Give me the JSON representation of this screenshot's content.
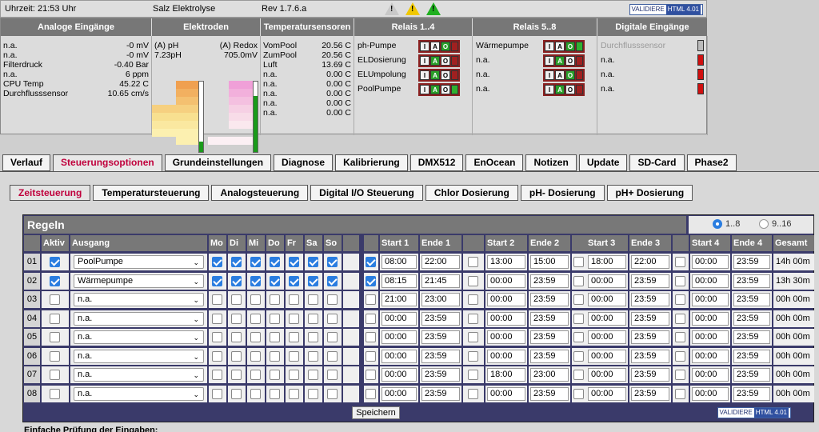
{
  "statusbar": {
    "time": "Uhrzeit: 21:53 Uhr",
    "device": "Salz Elektrolyse",
    "rev": "Rev 1.7.6.a",
    "badge_left": "VALIDIERE",
    "badge_right": "HTML 4.01"
  },
  "panel": {
    "headers": [
      "Analoge Eingänge",
      "Elektroden",
      "Temperatursensoren",
      "Relais 1..4",
      "Relais 5..8",
      "Digitale Eingänge"
    ],
    "analog": [
      {
        "l": "n.a.",
        "v": "-0 mV"
      },
      {
        "l": "n.a.",
        "v": "-0 mV"
      },
      {
        "l": "Filterdruck",
        "v": "-0.40 Bar"
      },
      {
        "l": "n.a.",
        "v": "6 ppm"
      },
      {
        "l": "CPU Temp",
        "v": "45.22 C"
      },
      {
        "l": "Durchflusssensor",
        "v": "10.65 cm/s"
      }
    ],
    "electrodes": {
      "ph_label": "(A) pH",
      "ph_value": "7.23pH",
      "redox_label": "(A) Redox",
      "redox_value": "705.0mV",
      "ph_level": 0.15,
      "redox_level": 0.8
    },
    "temps": [
      {
        "l": "VomPool",
        "v": "20.56 C"
      },
      {
        "l": "ZumPool",
        "v": "20.56 C"
      },
      {
        "l": "Luft",
        "v": "13.69 C"
      },
      {
        "l": "n.a.",
        "v": "0.00 C"
      },
      {
        "l": "n.a.",
        "v": "0.00 C"
      },
      {
        "l": "n.a.",
        "v": "0.00 C"
      },
      {
        "l": "n.a.",
        "v": "0.00 C"
      },
      {
        "l": "n.a.",
        "v": "0.00 C"
      }
    ],
    "relays1": [
      {
        "l": "ph-Pumpe",
        "s": "off"
      },
      {
        "l": "ELDosierung",
        "s": "auto"
      },
      {
        "l": "ELUmpolung",
        "s": "auto"
      },
      {
        "l": "PoolPumpe",
        "s": "auto",
        "on": true
      }
    ],
    "relays2": [
      {
        "l": "Wärmepumpe",
        "s": "off",
        "on": true
      },
      {
        "l": "n.a.",
        "s": "auto"
      },
      {
        "l": "n.a.",
        "s": "off"
      },
      {
        "l": "n.a.",
        "s": "auto"
      }
    ],
    "relay_letters": [
      "I",
      "A",
      "O"
    ],
    "digital": [
      {
        "l": "Durchflusssensor",
        "dim": true
      },
      {
        "l": "n.a."
      },
      {
        "l": "n.a."
      },
      {
        "l": "n.a."
      }
    ]
  },
  "tabs": [
    "Verlauf",
    "Steuerungsoptionen",
    "Grundeinstellungen",
    "Diagnose",
    "Kalibrierung",
    "DMX512",
    "EnOcean",
    "Notizen",
    "Update",
    "SD-Card",
    "Phase2"
  ],
  "active_tab": 1,
  "subtabs": [
    "Zeitsteuerung",
    "Temperatursteuerung",
    "Analogsteuerung",
    "Digital I/O Steuerung",
    "Chlor Dosierung",
    "pH- Dosierung",
    "pH+ Dosierung"
  ],
  "active_subtab": 0,
  "rules": {
    "title": "Regeln",
    "range_options": [
      "1..8",
      "9..16"
    ],
    "range_selected": 0,
    "headers": {
      "aktiv": "Aktiv",
      "ausgang": "Ausgang",
      "days": [
        "Mo",
        "Di",
        "Mi",
        "Do",
        "Fr",
        "Sa",
        "So"
      ],
      "s1": "Start 1",
      "e1": "Ende 1",
      "s2": "Start 2",
      "e2": "Ende 2",
      "s3": "Start 3",
      "e3": "Ende 3",
      "s4": "Start 4",
      "e4": "Ende 4",
      "total": "Gesamt"
    },
    "rows": [
      {
        "n": "01",
        "aktiv": true,
        "out": "PoolPumpe",
        "days": [
          true,
          true,
          true,
          true,
          true,
          true,
          true
        ],
        "en": [
          true,
          false,
          false,
          false
        ],
        "t": [
          [
            "08:00",
            "22:00"
          ],
          [
            "13:00",
            "15:00"
          ],
          [
            "18:00",
            "22:00"
          ],
          [
            "00:00",
            "23:59"
          ]
        ],
        "total": "14h 00m"
      },
      {
        "n": "02",
        "aktiv": true,
        "out": "Wärmepumpe",
        "days": [
          true,
          true,
          true,
          true,
          true,
          true,
          true
        ],
        "en": [
          true,
          false,
          false,
          false
        ],
        "t": [
          [
            "08:15",
            "21:45"
          ],
          [
            "00:00",
            "23:59"
          ],
          [
            "00:00",
            "23:59"
          ],
          [
            "00:00",
            "23:59"
          ]
        ],
        "total": "13h 30m"
      },
      {
        "n": "03",
        "aktiv": false,
        "out": "n.a.",
        "days": [
          false,
          false,
          false,
          false,
          false,
          false,
          false
        ],
        "en": [
          false,
          false,
          false,
          false
        ],
        "t": [
          [
            "21:00",
            "23:00"
          ],
          [
            "00:00",
            "23:59"
          ],
          [
            "00:00",
            "23:59"
          ],
          [
            "00:00",
            "23:59"
          ]
        ],
        "total": "00h 00m"
      },
      {
        "n": "04",
        "aktiv": false,
        "out": "n.a.",
        "days": [
          false,
          false,
          false,
          false,
          false,
          false,
          false
        ],
        "en": [
          false,
          false,
          false,
          false
        ],
        "t": [
          [
            "00:00",
            "23:59"
          ],
          [
            "00:00",
            "23:59"
          ],
          [
            "00:00",
            "23:59"
          ],
          [
            "00:00",
            "23:59"
          ]
        ],
        "total": "00h 00m"
      },
      {
        "n": "05",
        "aktiv": false,
        "out": "n.a.",
        "days": [
          false,
          false,
          false,
          false,
          false,
          false,
          false
        ],
        "en": [
          false,
          false,
          false,
          false
        ],
        "t": [
          [
            "00:00",
            "23:59"
          ],
          [
            "00:00",
            "23:59"
          ],
          [
            "00:00",
            "23:59"
          ],
          [
            "00:00",
            "23:59"
          ]
        ],
        "total": "00h 00m"
      },
      {
        "n": "06",
        "aktiv": false,
        "out": "n.a.",
        "days": [
          false,
          false,
          false,
          false,
          false,
          false,
          false
        ],
        "en": [
          false,
          false,
          false,
          false
        ],
        "t": [
          [
            "00:00",
            "23:59"
          ],
          [
            "00:00",
            "23:59"
          ],
          [
            "00:00",
            "23:59"
          ],
          [
            "00:00",
            "23:59"
          ]
        ],
        "total": "00h 00m"
      },
      {
        "n": "07",
        "aktiv": false,
        "out": "n.a.",
        "days": [
          false,
          false,
          false,
          false,
          false,
          false,
          false
        ],
        "en": [
          false,
          false,
          false,
          false
        ],
        "t": [
          [
            "00:00",
            "23:59"
          ],
          [
            "18:00",
            "23:00"
          ],
          [
            "00:00",
            "23:59"
          ],
          [
            "00:00",
            "23:59"
          ]
        ],
        "total": "00h 00m"
      },
      {
        "n": "08",
        "aktiv": false,
        "out": "n.a.",
        "days": [
          false,
          false,
          false,
          false,
          false,
          false,
          false
        ],
        "en": [
          false,
          false,
          false,
          false
        ],
        "t": [
          [
            "00:00",
            "23:59"
          ],
          [
            "00:00",
            "23:59"
          ],
          [
            "00:00",
            "23:59"
          ],
          [
            "00:00",
            "23:59"
          ]
        ],
        "total": "00h 00m"
      }
    ],
    "save": "Speichern"
  },
  "footnote": "Einfache Prüfung der Eingaben:"
}
